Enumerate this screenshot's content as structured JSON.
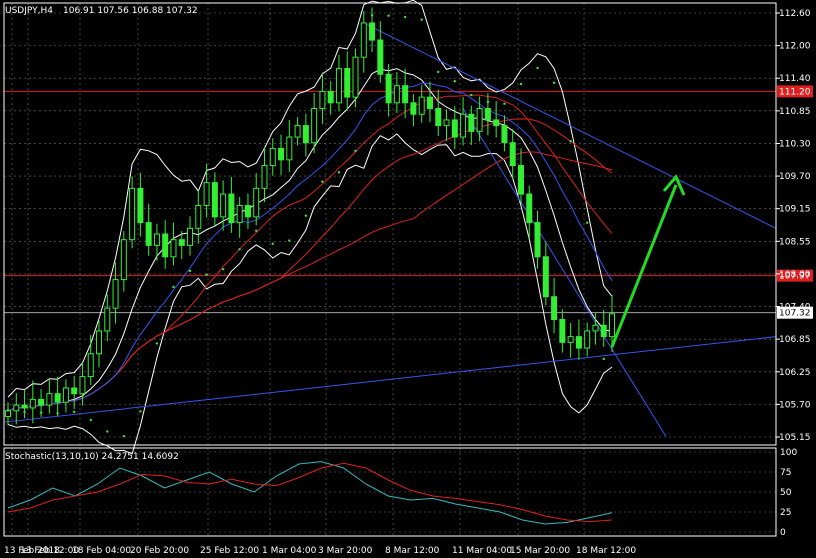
{
  "chart_data": [
    {
      "type": "candlestick",
      "symbol_label": "USDJPY,H4",
      "ohlc_label": "106.91 107.56 106.88 107.32",
      "current_price": 107.32,
      "current_price_label": "107.32",
      "ylim": [
        105.0,
        112.75
      ],
      "y_ticks": [
        "112.60",
        "112.00",
        "111.40",
        "110.85",
        "110.30",
        "109.70",
        "109.15",
        "108.55",
        "108.00",
        "107.40",
        "106.85",
        "106.25",
        "105.70",
        "105.15"
      ],
      "x_ticks": [
        "13 Feb 2018",
        "13 Feb 12:00",
        "18 Feb 04:00",
        "20 Feb 20:00",
        "25 Feb 12:00",
        "1 Mar 04:00",
        "3 Mar 20:00",
        "8 Mar 12:00",
        "11 Mar 04:00",
        "15 Mar 20:00",
        "18 Mar 12:00"
      ],
      "horizontal_levels": [
        {
          "value": 112.75,
          "label": "",
          "color": "#e02020"
        },
        {
          "value": 111.2,
          "label": "111.20",
          "color": "#e02020"
        },
        {
          "value": 107.97,
          "label": "107.97",
          "color": "#e02020"
        }
      ],
      "grid": true,
      "candle_color": "#33ee33",
      "forecast_arrow": {
        "from": [
          110,
          106.72
        ],
        "to": [
          125,
          109.7
        ],
        "color": "#22dd22"
      },
      "closes_approx": [
        105.6,
        105.7,
        105.65,
        105.8,
        105.7,
        105.9,
        105.75,
        106.0,
        105.9,
        106.2,
        106.6,
        107.0,
        107.4,
        107.9,
        108.6,
        109.5,
        108.9,
        108.5,
        108.7,
        108.3,
        108.6,
        108.5,
        108.8,
        109.2,
        109.6,
        109.0,
        109.4,
        108.9,
        109.2,
        109.0,
        109.5,
        109.9,
        110.2,
        110.0,
        110.4,
        110.6,
        110.3,
        110.9,
        111.2,
        111.0,
        111.6,
        111.1,
        111.8,
        112.4,
        112.1,
        111.5,
        111.0,
        111.3,
        111.0,
        110.8,
        111.1,
        110.9,
        110.6,
        110.7,
        110.4,
        110.8,
        110.5,
        110.9,
        110.7,
        110.6,
        110.3,
        109.9,
        109.4,
        108.9,
        108.3,
        107.6,
        107.2,
        106.8,
        106.9,
        106.7,
        107.0,
        107.1,
        106.9,
        107.3
      ],
      "indicators": [
        "Bollinger Bands",
        "Parabolic SAR",
        "Moving Averages"
      ]
    },
    {
      "type": "line",
      "label": "Stochastic(13,10,10) 24.2751 14.6092",
      "ylim": [
        0,
        100
      ],
      "y_ticks": [
        "100",
        "75",
        "50",
        "25",
        "0"
      ],
      "series": [
        {
          "name": "main",
          "color": "#33bbbb",
          "values": [
            30,
            40,
            55,
            45,
            60,
            80,
            70,
            55,
            65,
            75,
            60,
            50,
            70,
            85,
            88,
            80,
            60,
            45,
            40,
            42,
            35,
            30,
            25,
            15,
            10,
            12,
            18,
            24
          ]
        },
        {
          "name": "signal",
          "color": "#dd2020",
          "values": [
            25,
            30,
            40,
            45,
            50,
            60,
            72,
            70,
            62,
            60,
            66,
            60,
            58,
            68,
            80,
            86,
            80,
            65,
            52,
            45,
            42,
            38,
            34,
            28,
            20,
            15,
            13,
            15
          ]
        }
      ]
    }
  ]
}
